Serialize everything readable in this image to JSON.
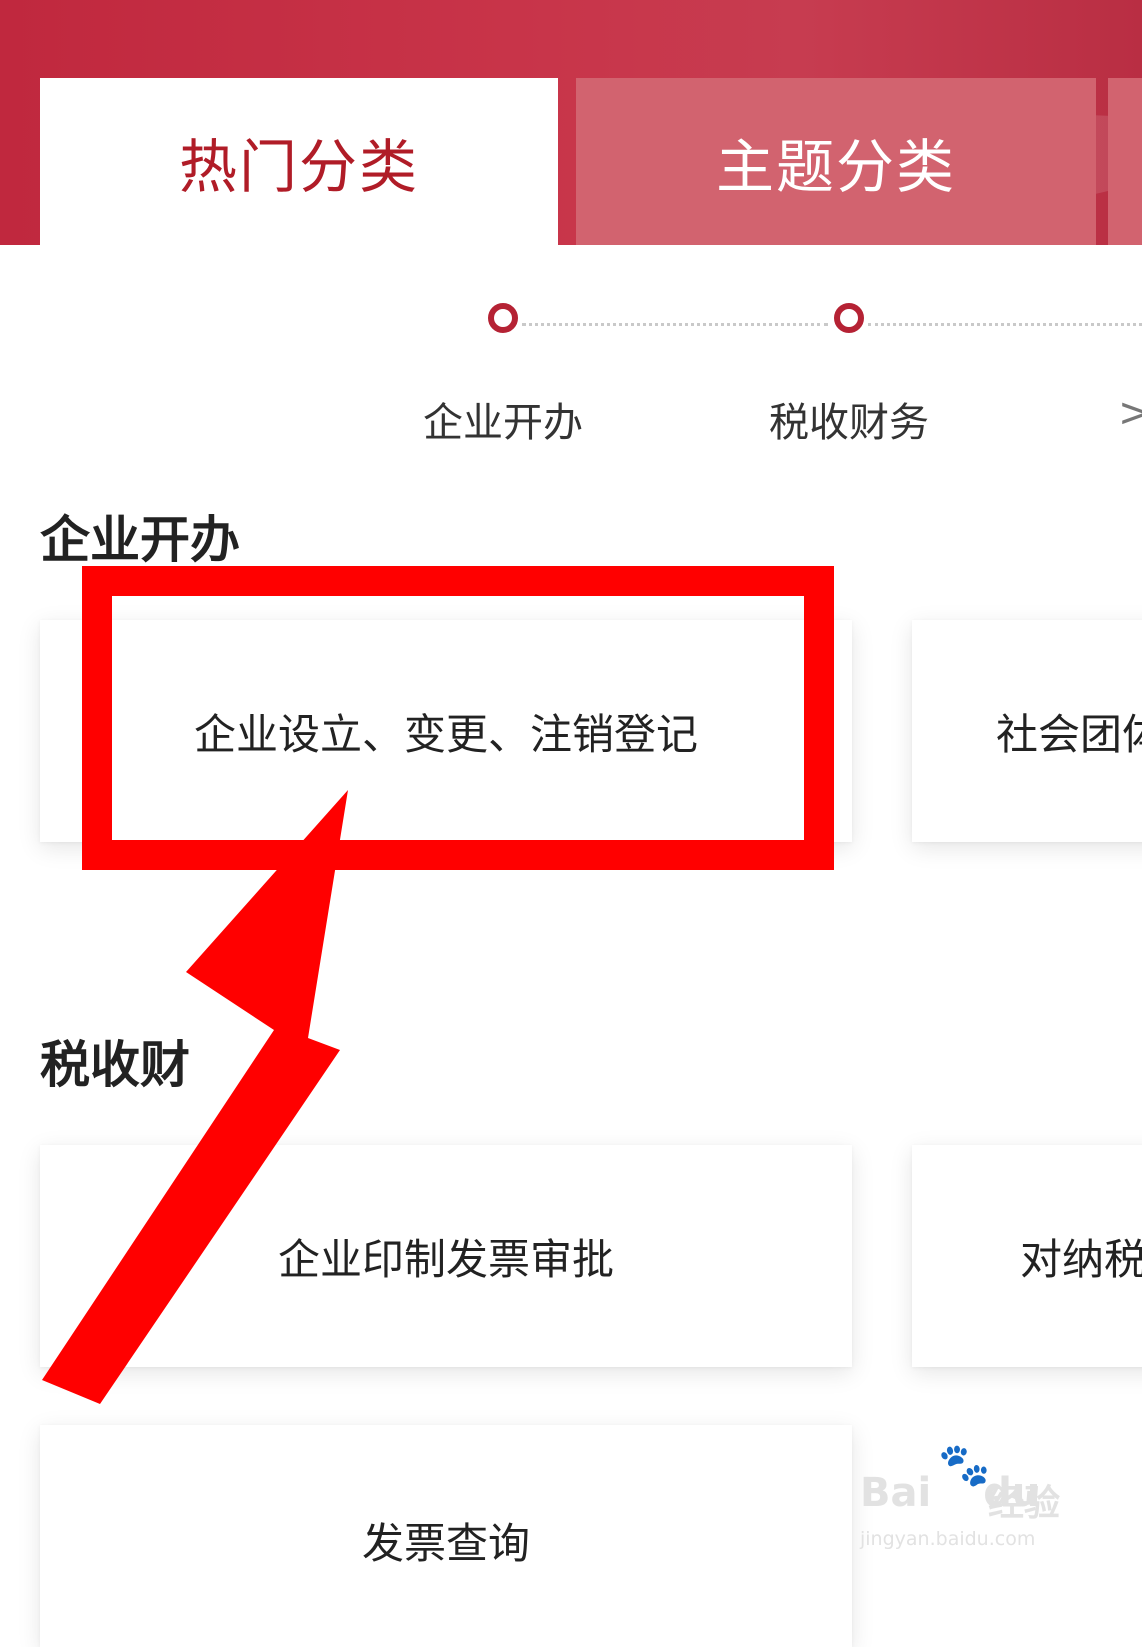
{
  "tabs": [
    {
      "label": "热门分类",
      "active": true
    },
    {
      "label": "主题分类",
      "active": false
    }
  ],
  "timeline": {
    "nodes": [
      {
        "label": "企业开办"
      },
      {
        "label": "税收财务"
      },
      {
        "label": ">"
      }
    ]
  },
  "sections": [
    {
      "title": "企业开办",
      "cards": [
        "企业设立、变更、注销登记",
        "社会团体"
      ]
    },
    {
      "title": "税收财",
      "cards": [
        "企业印制发票审批",
        "对纳税",
        "发票查询"
      ]
    }
  ],
  "colors": {
    "brand_red": "#c0283e",
    "tab_inactive": "#d2636f",
    "annotation_red": "#ff0000"
  },
  "watermark": {
    "brand": "Bai",
    "brand2": "du",
    "product": "经验",
    "url": "jingyan.baidu.com"
  }
}
